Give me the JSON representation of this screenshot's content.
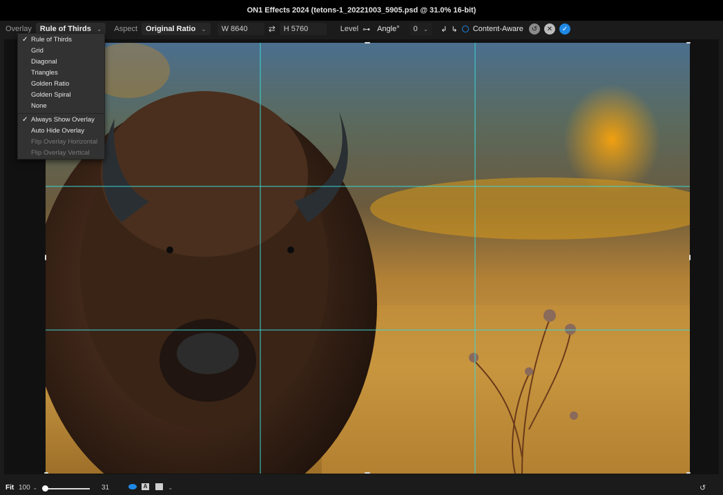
{
  "window": {
    "title": "ON1 Effects 2024 (tetons-1_20221003_5905.psd @ 31.0% 16-bit)"
  },
  "toolbar": {
    "overlay_label": "Overlay",
    "overlay_value": "Rule of Thirds",
    "aspect_label": "Aspect",
    "aspect_value": "Original Ratio",
    "width_field": "W 8640",
    "height_field": "H 5760",
    "level_label": "Level",
    "angle_label": "Angle°",
    "angle_value": "0",
    "content_aware_label": "Content-Aware"
  },
  "overlay_menu": {
    "items": [
      {
        "label": "Rule of Thirds",
        "checked": true
      },
      {
        "label": "Grid"
      },
      {
        "label": "Diagonal"
      },
      {
        "label": "Triangles"
      },
      {
        "label": "Golden Ratio"
      },
      {
        "label": "Golden Spiral"
      },
      {
        "label": "None"
      }
    ],
    "options": [
      {
        "label": "Always Show Overlay",
        "checked": true
      },
      {
        "label": "Auto Hide Overlay"
      },
      {
        "label": "Flip Overlay Horizontal",
        "disabled": true
      },
      {
        "label": "Flip Overlay Vertical",
        "disabled": true
      }
    ]
  },
  "bottom": {
    "fit_label": "Fit",
    "zoom_value": "100",
    "slider_value": "31"
  },
  "colors": {
    "accent": "#1e88e5",
    "guide": "#3ad6d6"
  },
  "icons": [
    "chevron-down-icon",
    "swap-icon",
    "level-icon",
    "rotate-ccw-icon",
    "rotate-cw-icon",
    "radio-icon",
    "reset-icon",
    "cancel-icon",
    "confirm-icon",
    "eye-icon",
    "text-mask-icon",
    "mask-icon",
    "undo-icon"
  ]
}
